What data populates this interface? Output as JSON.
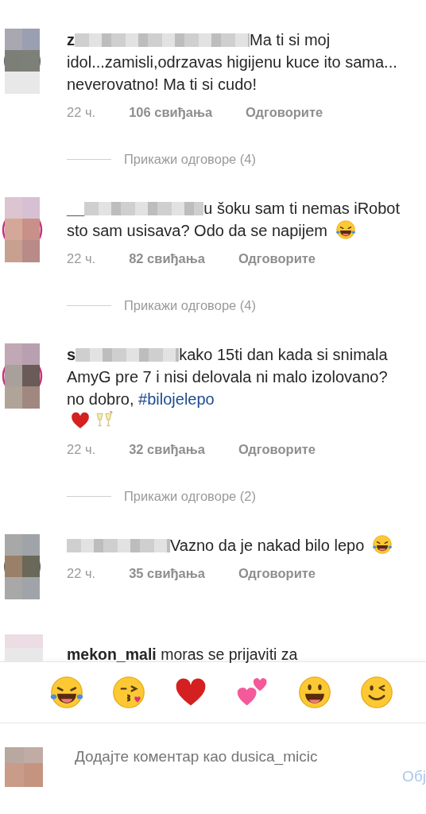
{
  "comments": [
    {
      "username": "z",
      "story_ring": false,
      "body": [
        {
          "kind": "text",
          "text": "Ma ti si moj idol...zamisli,odrzavas higijenu kuce ito sama... neverovatno! Ma ti si cudo!"
        }
      ],
      "time": "22 ч.",
      "likes": "106 свиђања",
      "reply": "Одговорите",
      "view_replies": "Прикажи одговоре (4)"
    },
    {
      "username": "__",
      "story_ring": true,
      "body": [
        {
          "kind": "text",
          "text": "u šoku sam ti nemas iRobot sto sam usisava? Odo da se napijem"
        },
        {
          "kind": "laugh"
        }
      ],
      "time": "22 ч.",
      "likes": "82 свиђања",
      "reply": "Одговорите",
      "view_replies": "Прикажи одговоре (4)"
    },
    {
      "username": "s",
      "story_ring": true,
      "body": [
        {
          "kind": "text",
          "text": "kako 15ti dan kada si snimala AmyG pre 7 i nisi delovala ni malo izolovano? no dobro,"
        },
        {
          "kind": "hashtag",
          "text": "#bilojelepo"
        },
        {
          "kind": "break"
        },
        {
          "kind": "heart"
        },
        {
          "kind": "glasses"
        }
      ],
      "time": "22 ч.",
      "likes": "32 свиђања",
      "reply": "Одговорите",
      "view_replies": "Прикажи одговоре (2)"
    },
    {
      "story_ring": false,
      "body": [
        {
          "kind": "text",
          "text": "Vazno da je nakad bilo lepo"
        },
        {
          "kind": "laugh"
        }
      ],
      "time": "22 ч.",
      "likes": "35 свиђања",
      "reply": "Одговорите"
    }
  ],
  "partial_comment": {
    "username": "mekon_mali",
    "text": "moras se prijaviti za"
  },
  "reactions": [
    {
      "kind": "laugh"
    },
    {
      "kind": "kiss"
    },
    {
      "kind": "heart"
    },
    {
      "kind": "hearts"
    },
    {
      "kind": "smile"
    },
    {
      "kind": "wink"
    }
  ],
  "composer": {
    "placeholder": "Додајте коментар као dusica_micic",
    "post": "Обј"
  }
}
